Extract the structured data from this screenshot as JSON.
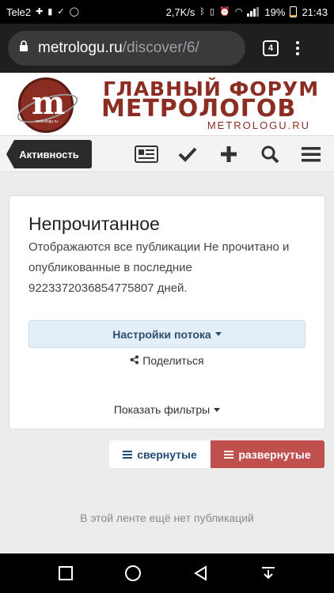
{
  "status_bar": {
    "carrier": "Tele2",
    "speed": "2,7K/s",
    "battery_percent": "19%",
    "time": "21:43"
  },
  "browser": {
    "url_domain": "metrologu.ru",
    "url_path": "/discover/6/",
    "tab_count": "4"
  },
  "site_header": {
    "logo_tag": "metrologu.ru",
    "title_line1": "ГЛАВНЫЙ ФОРУМ",
    "title_line2": "МЕТРОЛОГОВ",
    "subtitle": "METROLOGU.RU"
  },
  "nav": {
    "activity_label": "Активность",
    "icons": [
      "news-icon",
      "check-icon",
      "plus-icon",
      "search-icon",
      "menu-icon"
    ]
  },
  "card": {
    "title": "Непрочитанное",
    "description": "Отображаются все публикации Не прочитано и опубликованные в последние 9223372036854775807 дней.",
    "stream_settings_label": "Настройки потока",
    "share_label": "Поделиться",
    "show_filters_label": "Показать фильтры"
  },
  "view_toggle": {
    "collapsed_label": "свернутые",
    "expanded_label": "развернутые",
    "active": "expanded"
  },
  "empty_message": "В этой ленте ещё нет публикаций",
  "colors": {
    "brand": "#8b2d22",
    "active_toggle": "#c0504d",
    "stream_button_bg": "#e3eef8"
  }
}
